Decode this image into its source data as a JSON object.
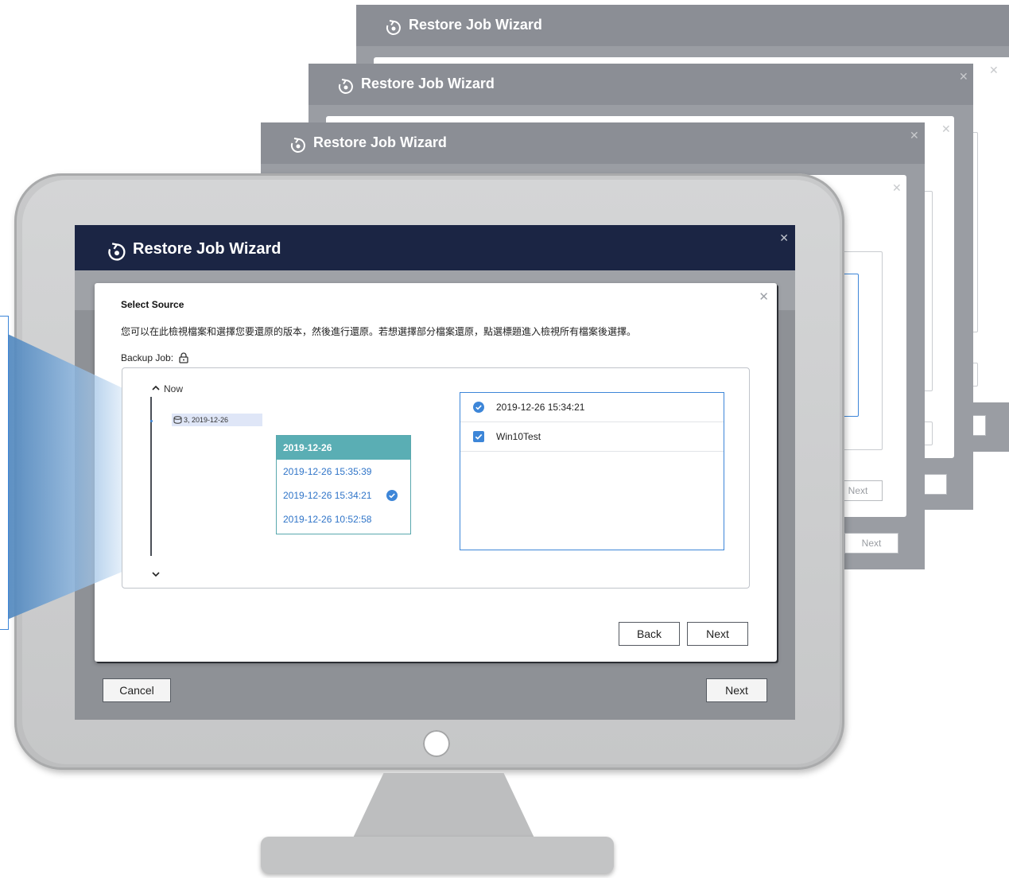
{
  "window": {
    "title": "Restore Job Wizard"
  },
  "dialog": {
    "title": "Select Source",
    "description": "您可以在此檢視檔案和選擇您要還原的版本，然後進行還原。若想選擇部分檔案還原，點選標題進入檢視所有檔案後選擇。",
    "backup_job_label": "Backup Job:",
    "timeline": {
      "now_label": "Now",
      "version_tag": "3, 2019-12-26"
    },
    "date_list": {
      "header": "2019-12-26",
      "items": [
        {
          "label": "2019-12-26 15:35:39",
          "selected": false
        },
        {
          "label": "2019-12-26 15:34:21",
          "selected": true
        },
        {
          "label": "2019-12-26 10:52:58",
          "selected": false
        }
      ]
    },
    "detail": {
      "version_label": "2019-12-26 15:34:21",
      "item_label": "Win10Test"
    },
    "back_label": "Back",
    "next_label": "Next"
  },
  "footer": {
    "cancel_label": "Cancel",
    "next_label": "Next"
  },
  "background_windows": {
    "next_label": "Next",
    "next_partial": "t"
  },
  "colors": {
    "header_dark": "#1b2544",
    "accent_blue": "#3d86d8",
    "teal_header": "#5aaeb4",
    "link_blue": "#2f74c8"
  }
}
